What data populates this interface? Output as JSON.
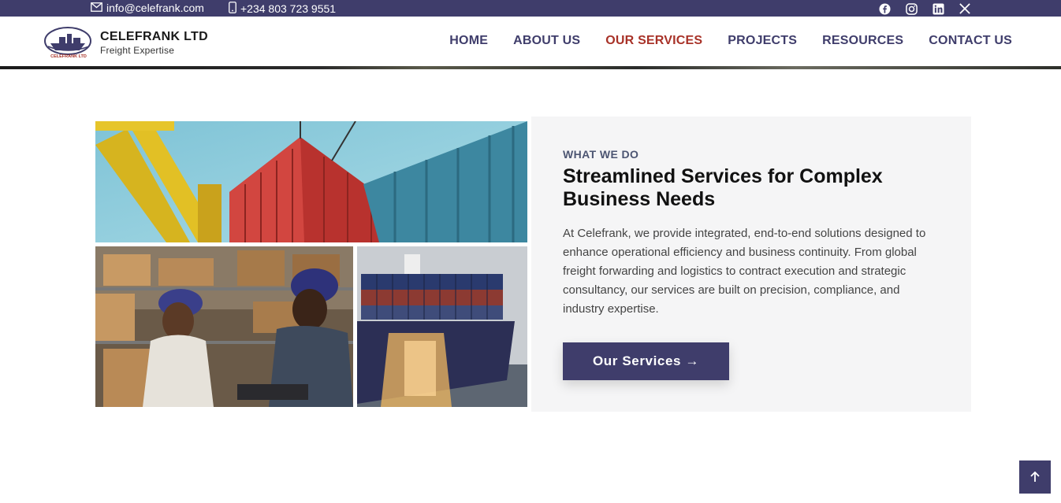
{
  "topbar": {
    "email": "info@celefrank.com",
    "phone": "+234 803 723 9551",
    "social": [
      "facebook-icon",
      "instagram-icon",
      "linkedin-icon",
      "x-icon"
    ]
  },
  "brand": {
    "name": "CELEFRANK LTD",
    "tagline": "Freight Expertise",
    "logo_text": "CELEFRANK LTD"
  },
  "nav": {
    "items": [
      "HOME",
      "ABOUT US",
      "OUR SERVICES",
      "PROJECTS",
      "RESOURCES",
      "CONTACT US"
    ],
    "active": "OUR SERVICES"
  },
  "section": {
    "eyebrow": "WHAT WE DO",
    "title": "Streamlined Services for Complex Business Needs",
    "description": "At Celefrank, we provide integrated, end-to-end solutions designed to enhance operational efficiency and business continuity. From global freight forwarding and logistics to contract execution and strategic consultancy, our services are built on precision, compliance, and industry expertise.",
    "cta_label": "Our Services →"
  },
  "colors": {
    "primary": "#3f3d6b",
    "active_nav": "#a83228",
    "panel_bg": "#f5f5f6"
  }
}
